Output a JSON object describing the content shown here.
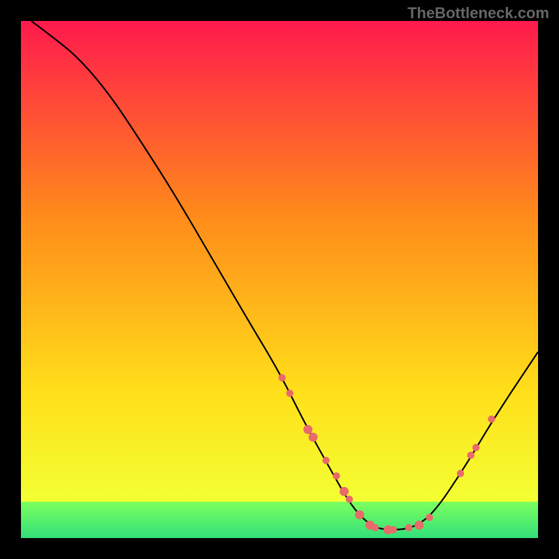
{
  "watermark": "TheBottleneck.com",
  "chart_data": {
    "type": "line",
    "title": "",
    "xlabel": "",
    "ylabel": "",
    "xlim": [
      0,
      100
    ],
    "ylim": [
      0,
      100
    ],
    "background_gradient": {
      "top": "#ff1a4d",
      "mid1": "#ff8c1a",
      "mid2": "#ffe01a",
      "bottom_band": "#33e07a"
    },
    "curve": {
      "description": "V-shaped bottleneck curve descending from top-left to a minimum near x≈68-72 then rising to right edge",
      "points": [
        {
          "x": 2,
          "y": 100
        },
        {
          "x": 6,
          "y": 97
        },
        {
          "x": 11,
          "y": 93
        },
        {
          "x": 17,
          "y": 86
        },
        {
          "x": 23,
          "y": 77
        },
        {
          "x": 30,
          "y": 66
        },
        {
          "x": 37,
          "y": 54
        },
        {
          "x": 44,
          "y": 42
        },
        {
          "x": 50,
          "y": 32
        },
        {
          "x": 55,
          "y": 22
        },
        {
          "x": 60,
          "y": 13
        },
        {
          "x": 64,
          "y": 6
        },
        {
          "x": 68,
          "y": 2
        },
        {
          "x": 72,
          "y": 1.5
        },
        {
          "x": 76,
          "y": 2
        },
        {
          "x": 80,
          "y": 5
        },
        {
          "x": 86,
          "y": 14
        },
        {
          "x": 92,
          "y": 24
        },
        {
          "x": 100,
          "y": 36
        }
      ]
    },
    "markers": {
      "color": "#e86a6a",
      "items": [
        {
          "x": 50.5,
          "y": 31,
          "r": 4
        },
        {
          "x": 52,
          "y": 28,
          "r": 4
        },
        {
          "x": 55.5,
          "y": 21,
          "r": 5
        },
        {
          "x": 56.5,
          "y": 19.5,
          "r": 5
        },
        {
          "x": 59,
          "y": 15,
          "r": 4
        },
        {
          "x": 61,
          "y": 12,
          "r": 4
        },
        {
          "x": 62.5,
          "y": 9,
          "r": 5
        },
        {
          "x": 63.5,
          "y": 7.5,
          "r": 4
        },
        {
          "x": 65.5,
          "y": 4.5,
          "r": 5
        },
        {
          "x": 67.5,
          "y": 2.5,
          "r": 5
        },
        {
          "x": 68.5,
          "y": 2,
          "r": 4
        },
        {
          "x": 71,
          "y": 1.6,
          "r": 5
        },
        {
          "x": 72,
          "y": 1.6,
          "r": 4
        },
        {
          "x": 75,
          "y": 2,
          "r": 4
        },
        {
          "x": 77,
          "y": 2.5,
          "r": 5
        },
        {
          "x": 79,
          "y": 4,
          "r": 4
        },
        {
          "x": 85,
          "y": 12.5,
          "r": 4
        },
        {
          "x": 87,
          "y": 16,
          "r": 4
        },
        {
          "x": 88,
          "y": 17.5,
          "r": 4
        },
        {
          "x": 91,
          "y": 23,
          "r": 4
        }
      ]
    }
  }
}
